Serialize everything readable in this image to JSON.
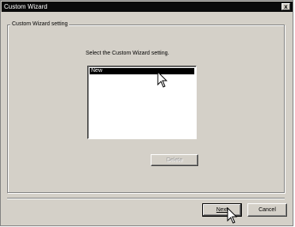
{
  "window": {
    "title": "Custom Wizard",
    "close_glyph": "x"
  },
  "group": {
    "label": "Custom Wizard setting"
  },
  "prompt": "Select the Custom Wizard setting.",
  "list": {
    "items": [
      "New"
    ],
    "selected": 0
  },
  "buttons": {
    "delete": "Delete",
    "next": "Next",
    "cancel": "Cancel"
  },
  "icons": {
    "cursor1": "arrow-cursor-icon",
    "cursor2": "arrow-cursor-icon"
  }
}
